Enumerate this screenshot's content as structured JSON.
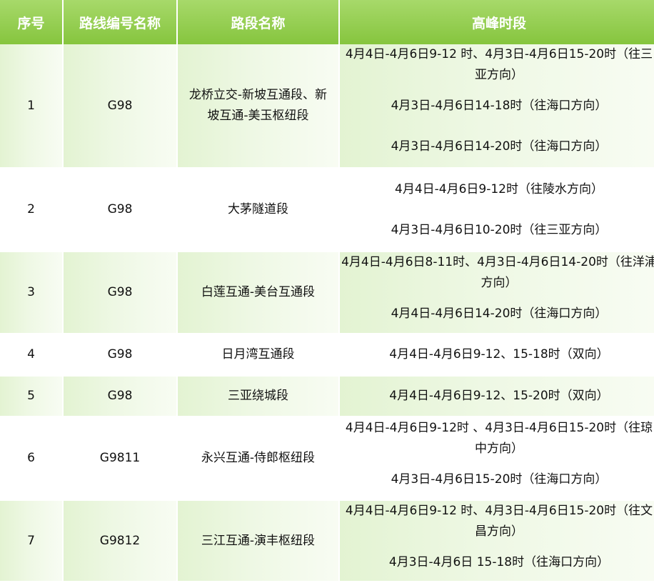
{
  "header": {
    "col1": "序号",
    "col2": "路线编号名称",
    "col3": "路段名称",
    "col4": "高峰时段"
  },
  "rows": [
    {
      "no": "1",
      "route": "G98",
      "section": "龙桥立交-新坡互通段、新坡互通-美玉枢纽段",
      "periods": [
        "4月4日-4月6日9-12 时、4月3日-4月6日15-20时（往三亚方向）",
        "4月3日-4月6日14-18时（往海口方向）",
        "4月3日-4月6日14-20时（往海口方向）"
      ]
    },
    {
      "no": "2",
      "route": "G98",
      "section": "大茅隧道段",
      "periods": [
        "4月4日-4月6日9-12时（往陵水方向）",
        "4月3日-4月6日10-20时（往三亚方向）"
      ]
    },
    {
      "no": "3",
      "route": "G98",
      "section": "白莲互通-美台互通段",
      "periods": [
        "4月4日-4月6日8-11时、4月3日-4月6日14-20时（往洋浦方向）",
        "4月4日-4月6日14-20时（往海口方向）"
      ]
    },
    {
      "no": "4",
      "route": "G98",
      "section": "日月湾互通段",
      "periods": [
        "4月4日-4月6日9-12、15-18时（双向）"
      ]
    },
    {
      "no": "5",
      "route": "G98",
      "section": "三亚绕城段",
      "periods": [
        "4月4日-4月6日9-12、15-20时（双向）"
      ]
    },
    {
      "no": "6",
      "route": "G9811",
      "section": "永兴互通-侍郎枢纽段",
      "periods": [
        "4月4日-4月6日9-12时 、4月3日-4月6日15-20时（往琼中方向）",
        "4月3日-4月6日15-20时（往海口方向）"
      ]
    },
    {
      "no": "7",
      "route": "G9812",
      "section": "三江互通-演丰枢纽段",
      "periods": [
        "4月4日-4月6日9-12 时、4月3日-4月6日15-20时（往文昌方向）",
        "4月3日-4月6日 15-18时（往海口方向）"
      ]
    }
  ]
}
